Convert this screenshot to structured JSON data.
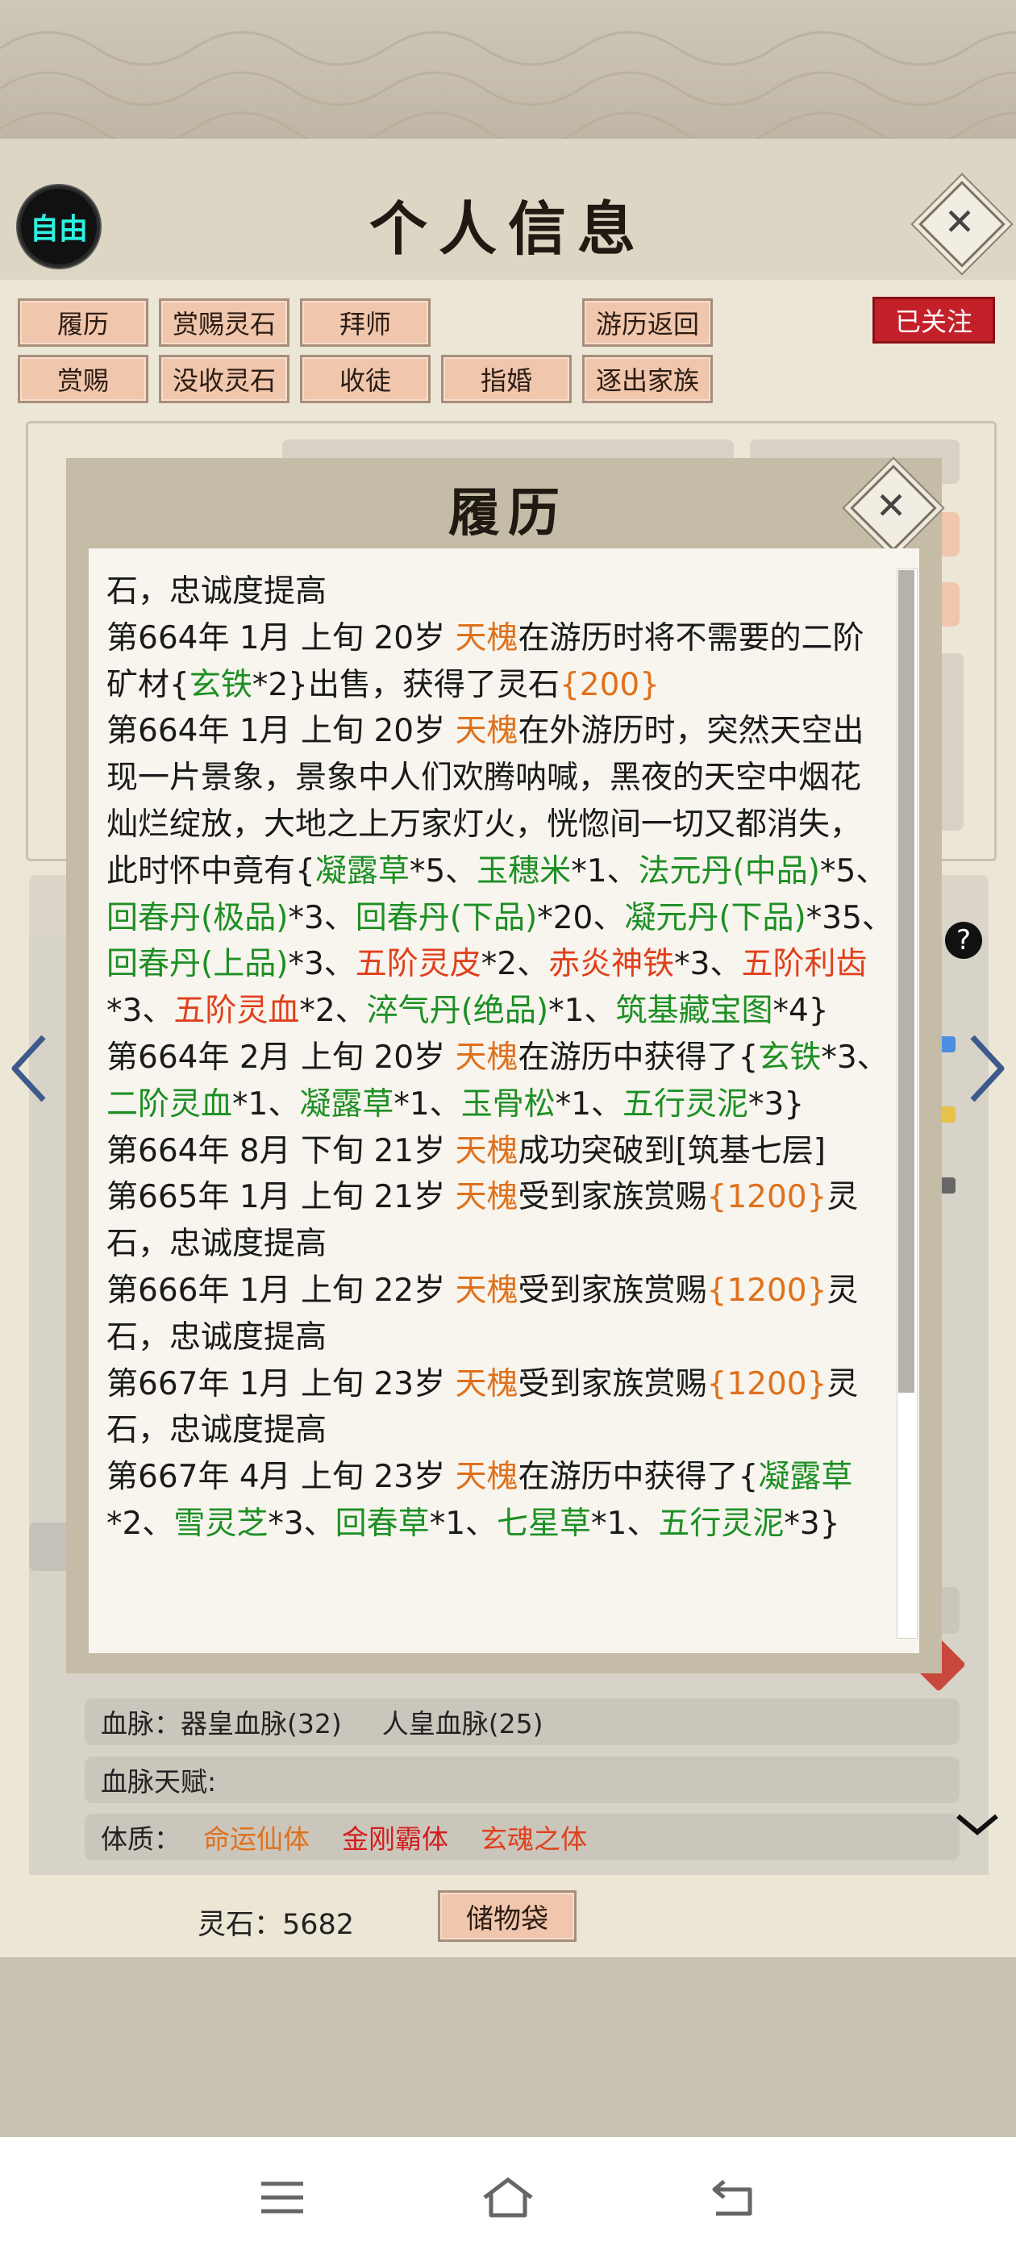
{
  "header": {
    "title": "个人信息",
    "badge": "自由",
    "followed": "已关注"
  },
  "action_buttons": [
    {
      "label": "履历"
    },
    {
      "label": "赏赐灵石"
    },
    {
      "label": "拜师"
    },
    {
      "label": "游历返回"
    },
    {
      "label": "赏赐"
    },
    {
      "label": "没收灵石"
    },
    {
      "label": "收徒"
    },
    {
      "label": "指婚"
    },
    {
      "label": "逐出家族"
    }
  ],
  "bloodline": {
    "label": "血脉：",
    "value1": "器皇血脉(32)",
    "value2": "人皇血脉(25)"
  },
  "bloodline_talent": {
    "label": "血脉天赋:"
  },
  "physique": {
    "label": "体质：",
    "items": [
      "命运仙体",
      "金刚霸体",
      "玄魂之体"
    ]
  },
  "spirit_stones": {
    "label": "灵石：5682"
  },
  "storage_bag": {
    "label": "储物袋"
  },
  "modal": {
    "title": "履历",
    "log": [
      [
        {
          "t": "石，忠诚度提高"
        }
      ],
      [
        {
          "t": "第664年 1月 上旬  20岁  "
        },
        {
          "t": "天槐",
          "c": "o"
        },
        {
          "t": "在游历时将不需要的二阶"
        }
      ],
      [
        {
          "t": "矿材{"
        },
        {
          "t": "玄铁",
          "c": "g"
        },
        {
          "t": "*2}出售，获得了灵石"
        },
        {
          "t": "{200}",
          "c": "o"
        }
      ],
      [
        {
          "t": "第664年 1月 上旬  20岁  "
        },
        {
          "t": "天槐",
          "c": "o"
        },
        {
          "t": "在外游历时，突然天空出"
        }
      ],
      [
        {
          "t": "现一片景象，景象中人们欢腾呐喊，黑夜的天空中烟花"
        }
      ],
      [
        {
          "t": "灿烂绽放，大地之上万家灯火，恍惚间一切又都消失，"
        }
      ],
      [
        {
          "t": "此时怀中竟有{"
        },
        {
          "t": "凝露草",
          "c": "g"
        },
        {
          "t": "*5、"
        },
        {
          "t": "玉穗米",
          "c": "g"
        },
        {
          "t": "*1、"
        },
        {
          "t": "法元丹(中品)",
          "c": "g"
        },
        {
          "t": "*5、"
        }
      ],
      [
        {
          "t": "回春丹(极品)",
          "c": "g"
        },
        {
          "t": "*3、"
        },
        {
          "t": "回春丹(下品)",
          "c": "g"
        },
        {
          "t": "*20、"
        },
        {
          "t": "凝元丹(下品)",
          "c": "g"
        },
        {
          "t": "*35、"
        }
      ],
      [
        {
          "t": "回春丹(上品)",
          "c": "g"
        },
        {
          "t": "*3、"
        },
        {
          "t": "五阶灵皮",
          "c": "r"
        },
        {
          "t": "*2、"
        },
        {
          "t": "赤炎神铁",
          "c": "r"
        },
        {
          "t": "*3、"
        },
        {
          "t": "五阶利齿",
          "c": "r"
        }
      ],
      [
        {
          "t": "*3、"
        },
        {
          "t": "五阶灵血",
          "c": "r"
        },
        {
          "t": "*2、"
        },
        {
          "t": "淬气丹(绝品)",
          "c": "g"
        },
        {
          "t": "*1、"
        },
        {
          "t": "筑基藏宝图",
          "c": "g"
        },
        {
          "t": "*4}"
        }
      ],
      [
        {
          "t": "第664年 2月 上旬 20岁  "
        },
        {
          "t": "天槐",
          "c": "o"
        },
        {
          "t": "在游历中获得了{"
        },
        {
          "t": "玄铁",
          "c": "g"
        },
        {
          "t": "*3、"
        }
      ],
      [
        {
          "t": "二阶灵血",
          "c": "g"
        },
        {
          "t": "*1、"
        },
        {
          "t": "凝露草",
          "c": "g"
        },
        {
          "t": "*1、"
        },
        {
          "t": "玉骨松",
          "c": "g"
        },
        {
          "t": "*1、"
        },
        {
          "t": "五行灵泥",
          "c": "g"
        },
        {
          "t": "*3}"
        }
      ],
      [
        {
          "t": "第664年 8月 下旬  21岁  "
        },
        {
          "t": "天槐",
          "c": "o"
        },
        {
          "t": "成功突破到[筑基七层]"
        }
      ],
      [
        {
          "t": "第665年 1月 上旬  21岁   "
        },
        {
          "t": "天槐",
          "c": "o"
        },
        {
          "t": "受到家族赏赐"
        },
        {
          "t": "{1200}",
          "c": "o"
        },
        {
          "t": "灵"
        }
      ],
      [
        {
          "t": "石，忠诚度提高"
        }
      ],
      [
        {
          "t": "第666年 1月 上旬  22岁   "
        },
        {
          "t": "天槐",
          "c": "o"
        },
        {
          "t": "受到家族赏赐"
        },
        {
          "t": "{1200}",
          "c": "o"
        },
        {
          "t": "灵"
        }
      ],
      [
        {
          "t": "石，忠诚度提高"
        }
      ],
      [
        {
          "t": "第667年 1月 上旬  23岁   "
        },
        {
          "t": "天槐",
          "c": "o"
        },
        {
          "t": "受到家族赏赐"
        },
        {
          "t": "{1200}",
          "c": "o"
        },
        {
          "t": "灵"
        }
      ],
      [
        {
          "t": "石，忠诚度提高"
        }
      ],
      [
        {
          "t": "第667年 4月 上旬  23岁  "
        },
        {
          "t": "天槐",
          "c": "o"
        },
        {
          "t": "在游历中获得了{"
        },
        {
          "t": "凝露草",
          "c": "g"
        }
      ],
      [
        {
          "t": "*2、"
        },
        {
          "t": "雪灵芝",
          "c": "g"
        },
        {
          "t": "*3、"
        },
        {
          "t": "回春草",
          "c": "g"
        },
        {
          "t": "*1、"
        },
        {
          "t": "七星草",
          "c": "g"
        },
        {
          "t": "*1、"
        },
        {
          "t": "五行灵泥",
          "c": "g"
        },
        {
          "t": "*3}"
        }
      ]
    ]
  },
  "colors": {
    "orange": "#e0711c",
    "green": "#1d8f24",
    "red": "#e0401c",
    "button_fill": "#f0c6ac",
    "followed": "#c4202a"
  },
  "icons": [
    "close-icon",
    "help-icon",
    "left-arrow-icon",
    "right-arrow-icon",
    "chevron-down-icon",
    "menu-icon",
    "home-icon",
    "back-icon"
  ]
}
